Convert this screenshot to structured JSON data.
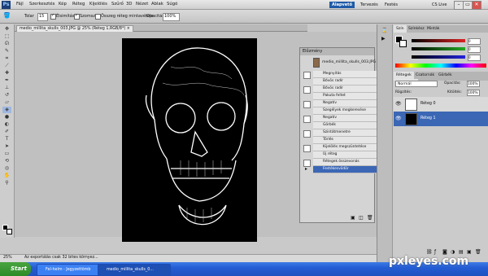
{
  "menubar": {
    "logo": "Ps",
    "items": [
      "Fájl",
      "Szerkesztés",
      "Kép",
      "Réteg",
      "Kijelölés",
      "Szűrő",
      "3D",
      "Nézet",
      "Ablak",
      "Súgó"
    ],
    "workspaces": [
      "Alapvető",
      "Tervezés",
      "Festés"
    ],
    "cslive": "CS Live",
    "controls": [
      "–",
      "▭",
      "✕"
    ]
  },
  "options": {
    "tolerance_label": "Tolar",
    "tolerance_value": "15",
    "antialias_label": "Élsimítás",
    "contiguous_label": "Szomsz",
    "all_layers_label": "Összeg réteg mintavétele",
    "opacity_label": "Opacitás",
    "opacity_value": "100%"
  },
  "document": {
    "tab_title": "medio_millita_skulls_003.JPG @ 25% (Réteg 1,RGB/8*) ×",
    "zoom": "25%",
    "status": "Az exportálás csak 32 bites környez..."
  },
  "history": {
    "title": "Előzmény",
    "snapshot": "medio_millita_skulls_003.JPG",
    "items": [
      "Megnyitás",
      "Bővös radír",
      "Bővös radír",
      "Pakuta feltet",
      "Negatív",
      "Szegélyek megkeresése",
      "Negatív",
      "Görbék",
      "Szintátmenetre",
      "Törlés",
      "Kijelölés megszüntetése",
      "Új réteg",
      "Rétegek összevonás",
      "Festékesvödör"
    ],
    "selected_index": 13
  },
  "color_panel": {
    "tabs": [
      "Szín",
      "Színkész",
      "Minták"
    ],
    "values": [
      "0",
      "0",
      "0"
    ],
    "slider_colors": [
      "#d22",
      "#2a2",
      "#22d"
    ]
  },
  "adjust_tabs": [
    "Korrekciók",
    "Maszkok"
  ],
  "layers_panel": {
    "tabs": [
      "Rétegek",
      "Csatornák",
      "Görbék"
    ],
    "blend_mode": "Normál",
    "opacity_label": "Opacitás:",
    "opacity_value": "100%",
    "lock_label": "Rögzítés:",
    "fill_label": "Kitöltés:",
    "fill_value": "100%",
    "layers": [
      {
        "name": "Réteg 0",
        "selected": false
      },
      {
        "name": "Réteg 1",
        "selected": true
      }
    ]
  },
  "taskbar": {
    "start": "Start",
    "tasks": [
      "Fel-helm - Jegyzettömb",
      "medio_millita_skulls_0..."
    ]
  },
  "watermark": "pxleyes.com"
}
